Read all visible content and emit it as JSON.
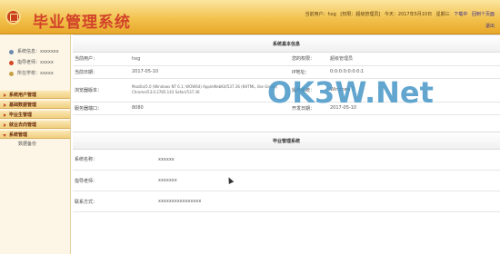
{
  "header": {
    "title": "毕业管理系统",
    "current_user_label": "当前用户：",
    "current_user": "hxg",
    "role": "[权限：超级管理员]",
    "date_prefix": "今天：",
    "date": "2017年5月10日",
    "weekday": "星期三",
    "logout_label": "下载中",
    "home_label": "回到个页面",
    "exit_label": "退出",
    "accent_color": "#d2422a",
    "bar_color": "#f2c24e"
  },
  "sidebar": {
    "profile": [
      {
        "label": "系统信息：",
        "value": "xxxxxxx",
        "icon": "user-icon",
        "color": "#6a8ab0"
      },
      {
        "label": "指导老师：",
        "value": "xxxxx",
        "icon": "teacher-icon",
        "color": "#d24a2a"
      },
      {
        "label": "所在学校：",
        "value": "xxxxx",
        "icon": "school-icon",
        "color": "#c8a04a"
      }
    ],
    "nav": [
      {
        "label": "系统用户管理",
        "open": false
      },
      {
        "label": "基础数据管理",
        "open": false
      },
      {
        "label": "毕业生管理",
        "open": false
      },
      {
        "label": "就业去向管理",
        "open": false
      },
      {
        "label": "系统管理",
        "open": true
      }
    ],
    "sub_items": [
      "数据备份"
    ]
  },
  "main": {
    "sys_info": {
      "heading": "系统基本信息",
      "rows": [
        {
          "l1": "当前用户：",
          "v1": "hxg",
          "l2": "您的权限：",
          "v2": "超级管理员"
        },
        {
          "l1": "当前日期：",
          "v1": "2017-05-10",
          "l2": "IP地址：",
          "v2": "0:0:0:0:0:0:0:1"
        },
        {
          "l1": "浏览器版本：",
          "v1": "Mozilla/5.0 (Windows NT 6.1; WOW64) AppleWebKit/537.36 (KHTML, like Gecko) Chrome/53.0.2785.143 Safari/537.36",
          "l2": "操作系统：",
          "v2": "Windows 7"
        },
        {
          "l1": "服务器端口：",
          "v1": "8080",
          "l2": "开发日期：",
          "v2": "2017-05-10"
        }
      ]
    },
    "grad_info": {
      "heading": "毕业管理系统",
      "rows": [
        {
          "label": "系统名称：",
          "value": "xxxxxx"
        },
        {
          "label": "指导老师：",
          "value": "xxxxxxx"
        },
        {
          "label": "联系方式：",
          "value": "xxxxxxxxxxxxxxxx"
        }
      ]
    }
  },
  "watermark": {
    "text_a": "OK3W",
    "dot": ".",
    "text_b": "Net"
  }
}
